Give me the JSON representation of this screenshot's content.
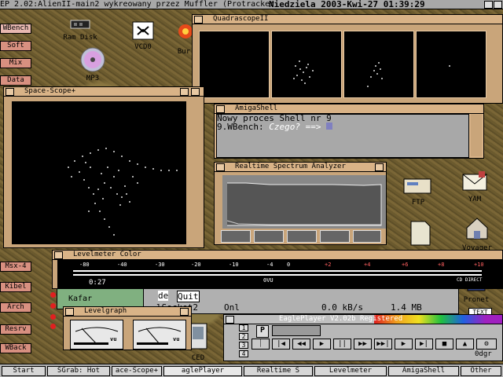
{
  "screen_title": "EP 2.02:AlienII-main2 wykreowany przez Muffler (Protracker",
  "screen_date": "Niedziela 2003-Kwi-27 01:39:29",
  "sidebar": {
    "top": [
      {
        "id": "wbench",
        "label": "WBench"
      },
      {
        "id": "soft",
        "label": "Soft"
      },
      {
        "id": "mix",
        "label": "Mix"
      },
      {
        "id": "data",
        "label": "Data"
      }
    ],
    "bottom": [
      {
        "id": "msx",
        "label": "Msx-4"
      },
      {
        "id": "kibel",
        "label": "Kibel"
      },
      {
        "id": "arch",
        "label": "Arch"
      },
      {
        "id": "resrv",
        "label": "Resrv"
      },
      {
        "id": "wback",
        "label": "WBack"
      }
    ]
  },
  "icons": {
    "ramdisk": "Ram Disk",
    "vcd": "VCD0",
    "bur": "Bur",
    "mp3": "MP3",
    "ftp": "FTP",
    "yam": "YAM",
    "voyager": "Voyager",
    "pronet": "Pronet",
    "ced": "CED",
    "text": "TEXT",
    "odgr": "0dgr"
  },
  "windows": {
    "quadrascope": {
      "title": "QuadrascopeII"
    },
    "spacescope": {
      "title": "Space-Scope+"
    },
    "shell": {
      "title": "AmigaShell",
      "line1": "Nowy proces Shell nr 9",
      "prompt": "9.WBench: ",
      "input": "Czego? ==> "
    },
    "spectrum": {
      "title": "Realtime Spectrum Analyzer"
    },
    "levelmeter": {
      "title": "Levelmeter Color",
      "scale": [
        "-80",
        "-40",
        "-30",
        "-20",
        "-10",
        "-4",
        "0",
        "+2",
        "+4",
        "+6",
        "+8",
        "+10"
      ],
      "readout": "0:27",
      "mark": "0VU",
      "cd": "CD DIRECT"
    },
    "levelgraph": {
      "title": "Levelgraph",
      "vu": "vu"
    },
    "background": {
      "kafar": "Kafar",
      "de": "de",
      "quit": "Quit",
      "socket": "lSocket2",
      "onl": "Onl",
      "speed": "0.0 kB/s",
      "size": "1.4 MB"
    },
    "eagleplayer": {
      "title": "EaglePlayer V2.02b Registered",
      "numbers": [
        "1",
        "2",
        "3",
        "4"
      ],
      "p": "P"
    }
  },
  "taskbar": [
    {
      "id": "start",
      "label": "Start"
    },
    {
      "id": "sgrab",
      "label": "SGrab: Hot"
    },
    {
      "id": "spacescope",
      "label": "ace-Scope+"
    },
    {
      "id": "eagle",
      "label": "aglePlayer"
    },
    {
      "id": "realtime",
      "label": "Realtime S"
    },
    {
      "id": "levelmeter",
      "label": "Levelmeter"
    },
    {
      "id": "amigashell",
      "label": "AmigaShell"
    },
    {
      "id": "other",
      "label": "Other"
    }
  ]
}
